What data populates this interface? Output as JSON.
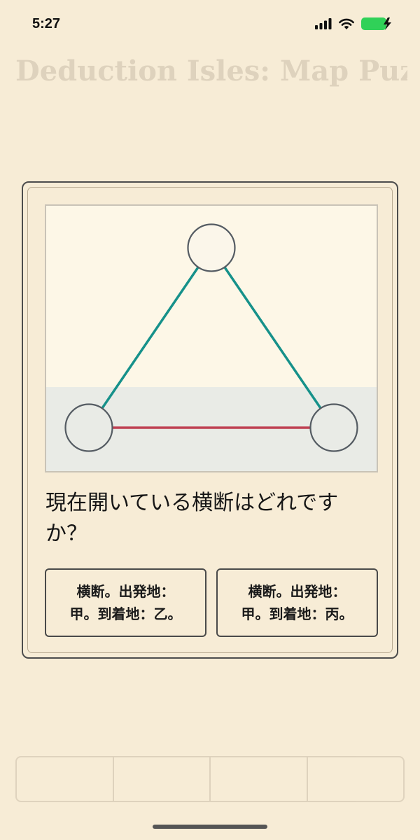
{
  "status": {
    "time": "5:27",
    "signal_icon": "signal-icon",
    "wifi_icon": "wifi-icon",
    "battery_icon": "battery-charging-icon",
    "battery_color": "#30d158"
  },
  "background": {
    "title": "Deduction Isles: Map Puzzle"
  },
  "map": {
    "nodes": [
      "top-island",
      "left-island",
      "right-island"
    ],
    "colors": {
      "land": "#fdf7e7",
      "water": "#e9ebe6",
      "node_fill": "#fbf6ea",
      "node_stroke": "#555c63",
      "open_route": "#16918a",
      "closed_route": "#bf4152"
    }
  },
  "modal": {
    "question": "現在開いている横断はどれですか？",
    "answers": [
      {
        "line1": "横断。出発地：",
        "line2": "甲。到着地：乙。"
      },
      {
        "line1": "横断。出発地：",
        "line2": "甲。到着地：丙。"
      }
    ]
  }
}
